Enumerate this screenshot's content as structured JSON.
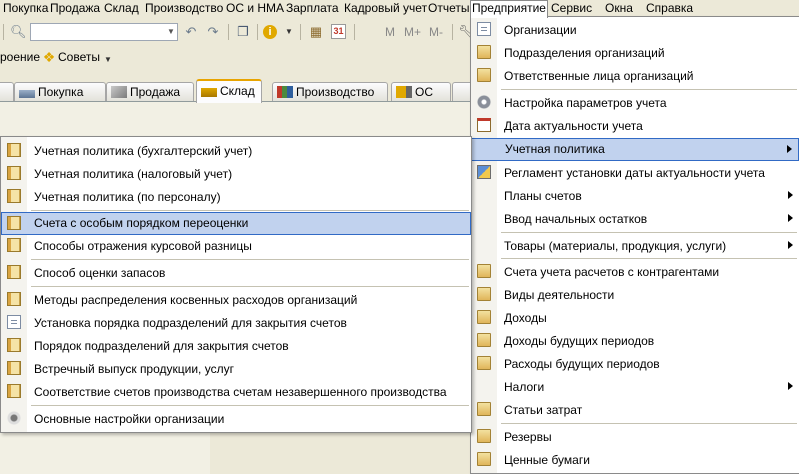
{
  "menubar": {
    "items": [
      "Покупка",
      "Продажа",
      "Склад",
      "Производство",
      "ОС и НМА",
      "Зарплата",
      "Кадровый учет",
      "Отчеты",
      "Предприятие",
      "Сервис",
      "Окна",
      "Справка"
    ],
    "active": "Предприятие"
  },
  "toolbar": {
    "combo_value": "",
    "m_labels": [
      "M",
      "M+",
      "M-"
    ],
    "advice_prefix": "роение",
    "advice_label": "Советы"
  },
  "tabs": [
    {
      "label": "Покупка",
      "icon": "cart-icon"
    },
    {
      "label": "Продажа",
      "icon": "truck-sale-icon"
    },
    {
      "label": "Склад",
      "icon": "warehouse-cart-icon",
      "active": true
    },
    {
      "label": "Производство",
      "icon": "factory-icon"
    },
    {
      "label": "ОС",
      "icon": "truck-icon"
    }
  ],
  "main_menu": {
    "items": [
      {
        "label": "Организации",
        "icon": "organization-icon"
      },
      {
        "label": "Подразделения организаций",
        "icon": "book-icon"
      },
      {
        "label": "Ответственные лица организаций",
        "icon": "book-icon"
      },
      {
        "label": "Настройка параметров учета",
        "icon": "gear-icon"
      },
      {
        "label": "Дата актуальности учета",
        "icon": "calendar-icon"
      },
      {
        "label": "Учетная политика",
        "icon": "",
        "submenu": true,
        "highlighted": true
      },
      {
        "label": "Регламент установки даты актуальности учета",
        "icon": "regulation-icon"
      },
      {
        "label": "Планы счетов",
        "icon": "",
        "submenu": true
      },
      {
        "label": "Ввод начальных остатков",
        "icon": "",
        "submenu": true
      },
      {
        "label": "Товары (материалы, продукция, услуги)",
        "icon": "",
        "submenu": true
      },
      {
        "label": "Счета учета расчетов с контрагентами",
        "icon": "book-icon"
      },
      {
        "label": "Виды деятельности",
        "icon": "book-icon"
      },
      {
        "label": "Доходы",
        "icon": "book-icon"
      },
      {
        "label": "Доходы будущих периодов",
        "icon": "book-icon"
      },
      {
        "label": "Расходы будущих периодов",
        "icon": "book-icon"
      },
      {
        "label": "Налоги",
        "icon": "",
        "submenu": true
      },
      {
        "label": "Статьи затрат",
        "icon": "book-icon"
      },
      {
        "label": "Резервы",
        "icon": "book-icon"
      },
      {
        "label": "Ценные бумаги",
        "icon": "book-icon"
      }
    ]
  },
  "sub_menu": {
    "items": [
      {
        "label": "Учетная политика (бухгалтерский учет)",
        "icon": "book-icon"
      },
      {
        "label": "Учетная политика (налоговый учет)",
        "icon": "book-icon"
      },
      {
        "label": "Учетная политика (по персоналу)",
        "icon": "book-icon"
      },
      {
        "label": "Счета с особым порядком переоценки",
        "icon": "book-icon",
        "highlighted": true
      },
      {
        "label": "Способы отражения курсовой разницы",
        "icon": "book-icon"
      },
      {
        "label": "Способ оценки запасов",
        "icon": "book-icon"
      },
      {
        "label": "Методы распределения косвенных расходов организаций",
        "icon": "book-icon"
      },
      {
        "label": "Установка порядка подразделений для закрытия счетов",
        "icon": "document-icon"
      },
      {
        "label": "Порядок подразделений для закрытия счетов",
        "icon": "book-icon"
      },
      {
        "label": "Встречный выпуск продукции, услуг",
        "icon": "book-icon"
      },
      {
        "label": "Соответствие счетов производства счетам незавершенного производства",
        "icon": "book-icon"
      },
      {
        "label": "Основные настройки организации",
        "icon": "settings-icon"
      }
    ]
  }
}
